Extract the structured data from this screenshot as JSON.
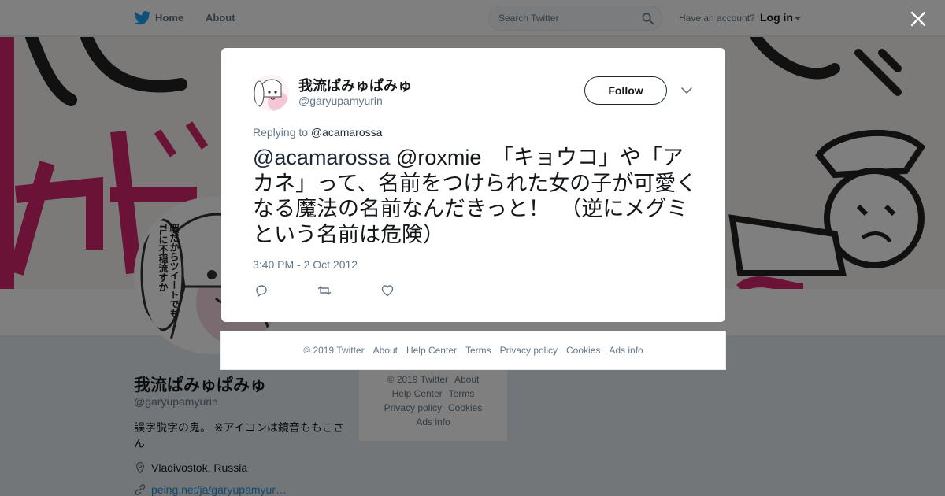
{
  "nav": {
    "home_label": "Home",
    "about_label": "About",
    "search_placeholder": "Search Twitter",
    "have_account": "Have an account?",
    "login_label": "Log in"
  },
  "profile": {
    "name": "我流ぱみゅぱみゅ",
    "handle": "@garyupamyurin",
    "bio": "誤字脱字の鬼。 ※アイコンは鏡音ももこさん",
    "location": "Vladivostok, Russia",
    "link": "peing.net/ja/garyupamyur…",
    "avatar_speech": "暇だからツイートでもTLに不穏流すか"
  },
  "side_footer": {
    "row1": [
      "© 2019 Twitter",
      "About"
    ],
    "row2": [
      "Help Center",
      "Terms"
    ],
    "row3": [
      "Privacy policy",
      "Cookies"
    ],
    "row4": [
      "Ads info"
    ]
  },
  "tweet": {
    "author_name": "我流ぱみゅぱみゅ",
    "author_handle": "@garyupamyurin",
    "follow_label": "Follow",
    "replying_prefix": "Replying to",
    "replying_to": "@acamarossa",
    "mention1": "@acamarossa",
    "mention2": "@roxmie",
    "body": "　「キョウコ」や「アカネ」って、名前をつけられた女の子が可愛くなる魔法の名前なんだきっと！　（逆にメグミという名前は危険）",
    "timestamp": "3:40 PM - 2 Oct 2012"
  },
  "modal_footer": {
    "items": [
      "© 2019 Twitter",
      "About",
      "Help Center",
      "Terms",
      "Privacy policy",
      "Cookies",
      "Ads info"
    ]
  },
  "colors": {
    "twitter_blue": "#1da1f2",
    "mention": "#1c2938",
    "muted": "#657786",
    "banner_magenta": "#d6246e"
  },
  "icons": {
    "logo": "twitter-bird-icon",
    "search": "search-icon",
    "close": "close-icon",
    "reply": "reply-icon",
    "retweet": "retweet-icon",
    "like": "heart-icon",
    "caret": "chevron-down-icon",
    "location": "location-pin-icon",
    "link": "link-icon"
  }
}
